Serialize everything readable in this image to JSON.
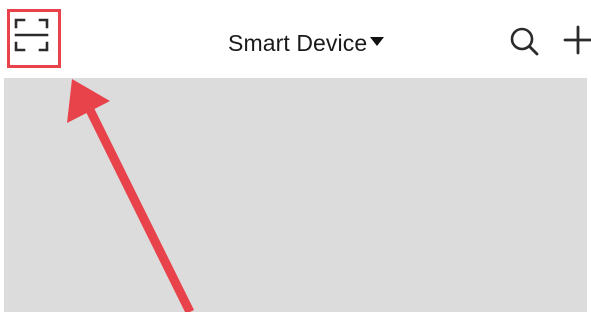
{
  "header": {
    "title": "Smart Device",
    "scan_icon": "scan-frame-icon",
    "caret_icon": "caret-down-icon",
    "search_icon": "search-icon",
    "add_icon": "plus-icon"
  },
  "annotation": {
    "highlight_color": "#e8434b",
    "arrow_color": "#e8434b",
    "target": "scan-button"
  },
  "colors": {
    "header_bg": "#ffffff",
    "content_bg": "#dcdcdc",
    "icon_color": "#2b2b2b"
  }
}
